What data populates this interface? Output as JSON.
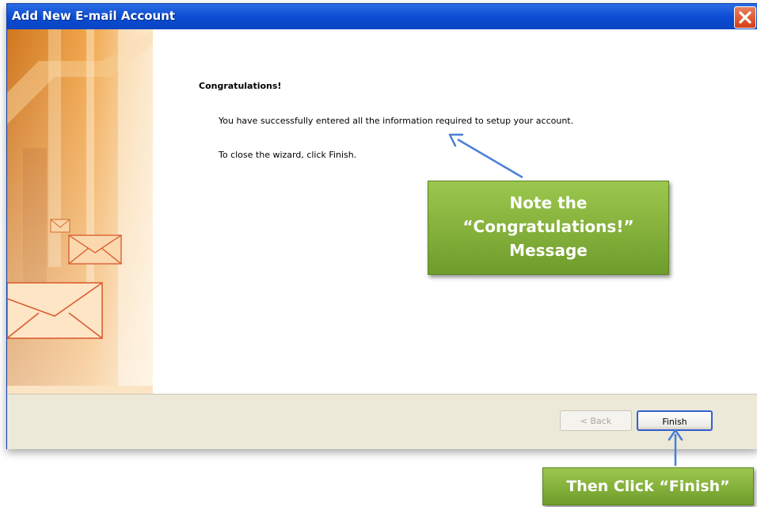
{
  "window": {
    "title": "Add New E-mail Account"
  },
  "main": {
    "heading": "Congratulations!",
    "message": "You have successfully entered all the information required to setup your account.",
    "instruction": "To close the wizard, click Finish."
  },
  "footer": {
    "back_label": "< Back",
    "finish_label": "Finish"
  },
  "annotations": {
    "note_line1": "Note the",
    "note_line2": "“Congratulations!”",
    "note_line3": "Message",
    "finish_callout": "Then Click “Finish”"
  },
  "icons": [
    "close-icon",
    "envelope-icon"
  ],
  "colors": {
    "titlebar": "#0b4bd2",
    "close_button": "#d63c14",
    "callout_green": "#7fad35",
    "arrow_blue": "#4a7fd6",
    "side_orange": "#e08a2a"
  }
}
